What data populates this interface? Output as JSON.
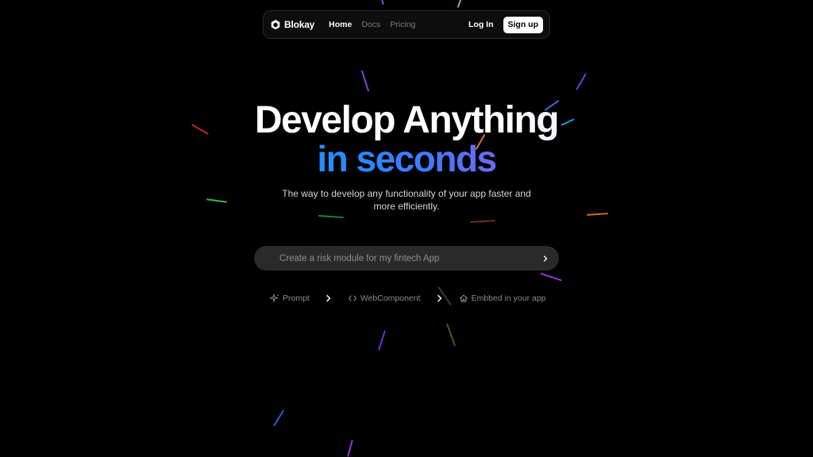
{
  "nav": {
    "brand": "Blokay",
    "links": [
      {
        "label": "Home",
        "active": true
      },
      {
        "label": "Docs",
        "active": false
      },
      {
        "label": "Pricing",
        "active": false
      }
    ],
    "login": "Log In",
    "signup": "Sign up"
  },
  "hero": {
    "line1": "Develop Anything",
    "line2": "in seconds",
    "subtitle": "The way to develop any functionality of your app faster and more efficiently."
  },
  "prompt": {
    "placeholder": "Create a risk module for my fintech App",
    "submit_icon": "chevron-right-icon"
  },
  "steps": [
    {
      "label": "Prompt",
      "icon": "sparkle-icon"
    },
    {
      "label": "WebComponent",
      "icon": "code-icon"
    },
    {
      "label": "Embbed in your app",
      "icon": "home-icon"
    }
  ],
  "colors": {
    "background": "#000000",
    "accent_blue": "#1f8fff",
    "accent_purple": "#6d6af3",
    "input_bg": "#2a2a2a"
  }
}
